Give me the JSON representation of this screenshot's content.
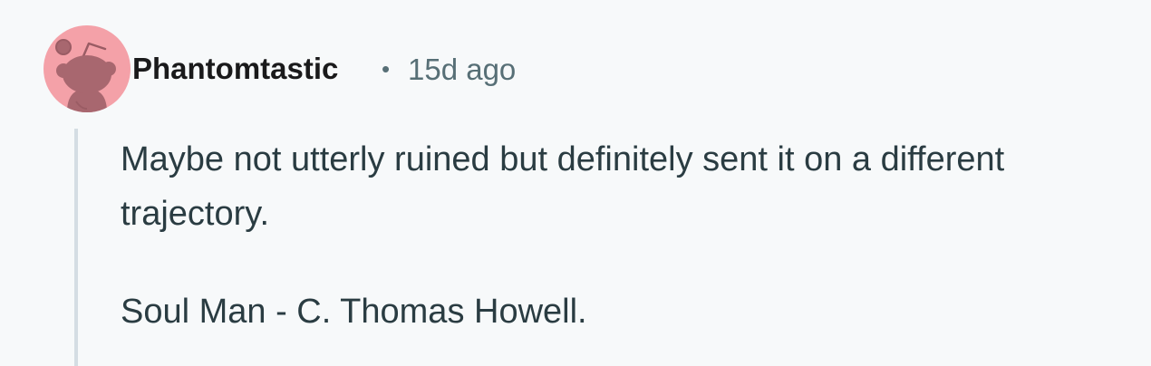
{
  "comment": {
    "author": "Phantomtastic",
    "separator": "•",
    "timestamp": "15d ago",
    "avatar_icon": "snoo-avatar-icon",
    "avatar_color": "#f4a1a8",
    "body": [
      "Maybe not utterly ruined but definitely sent it on a different trajectory.",
      "Soul Man - C. Thomas Howell."
    ]
  }
}
